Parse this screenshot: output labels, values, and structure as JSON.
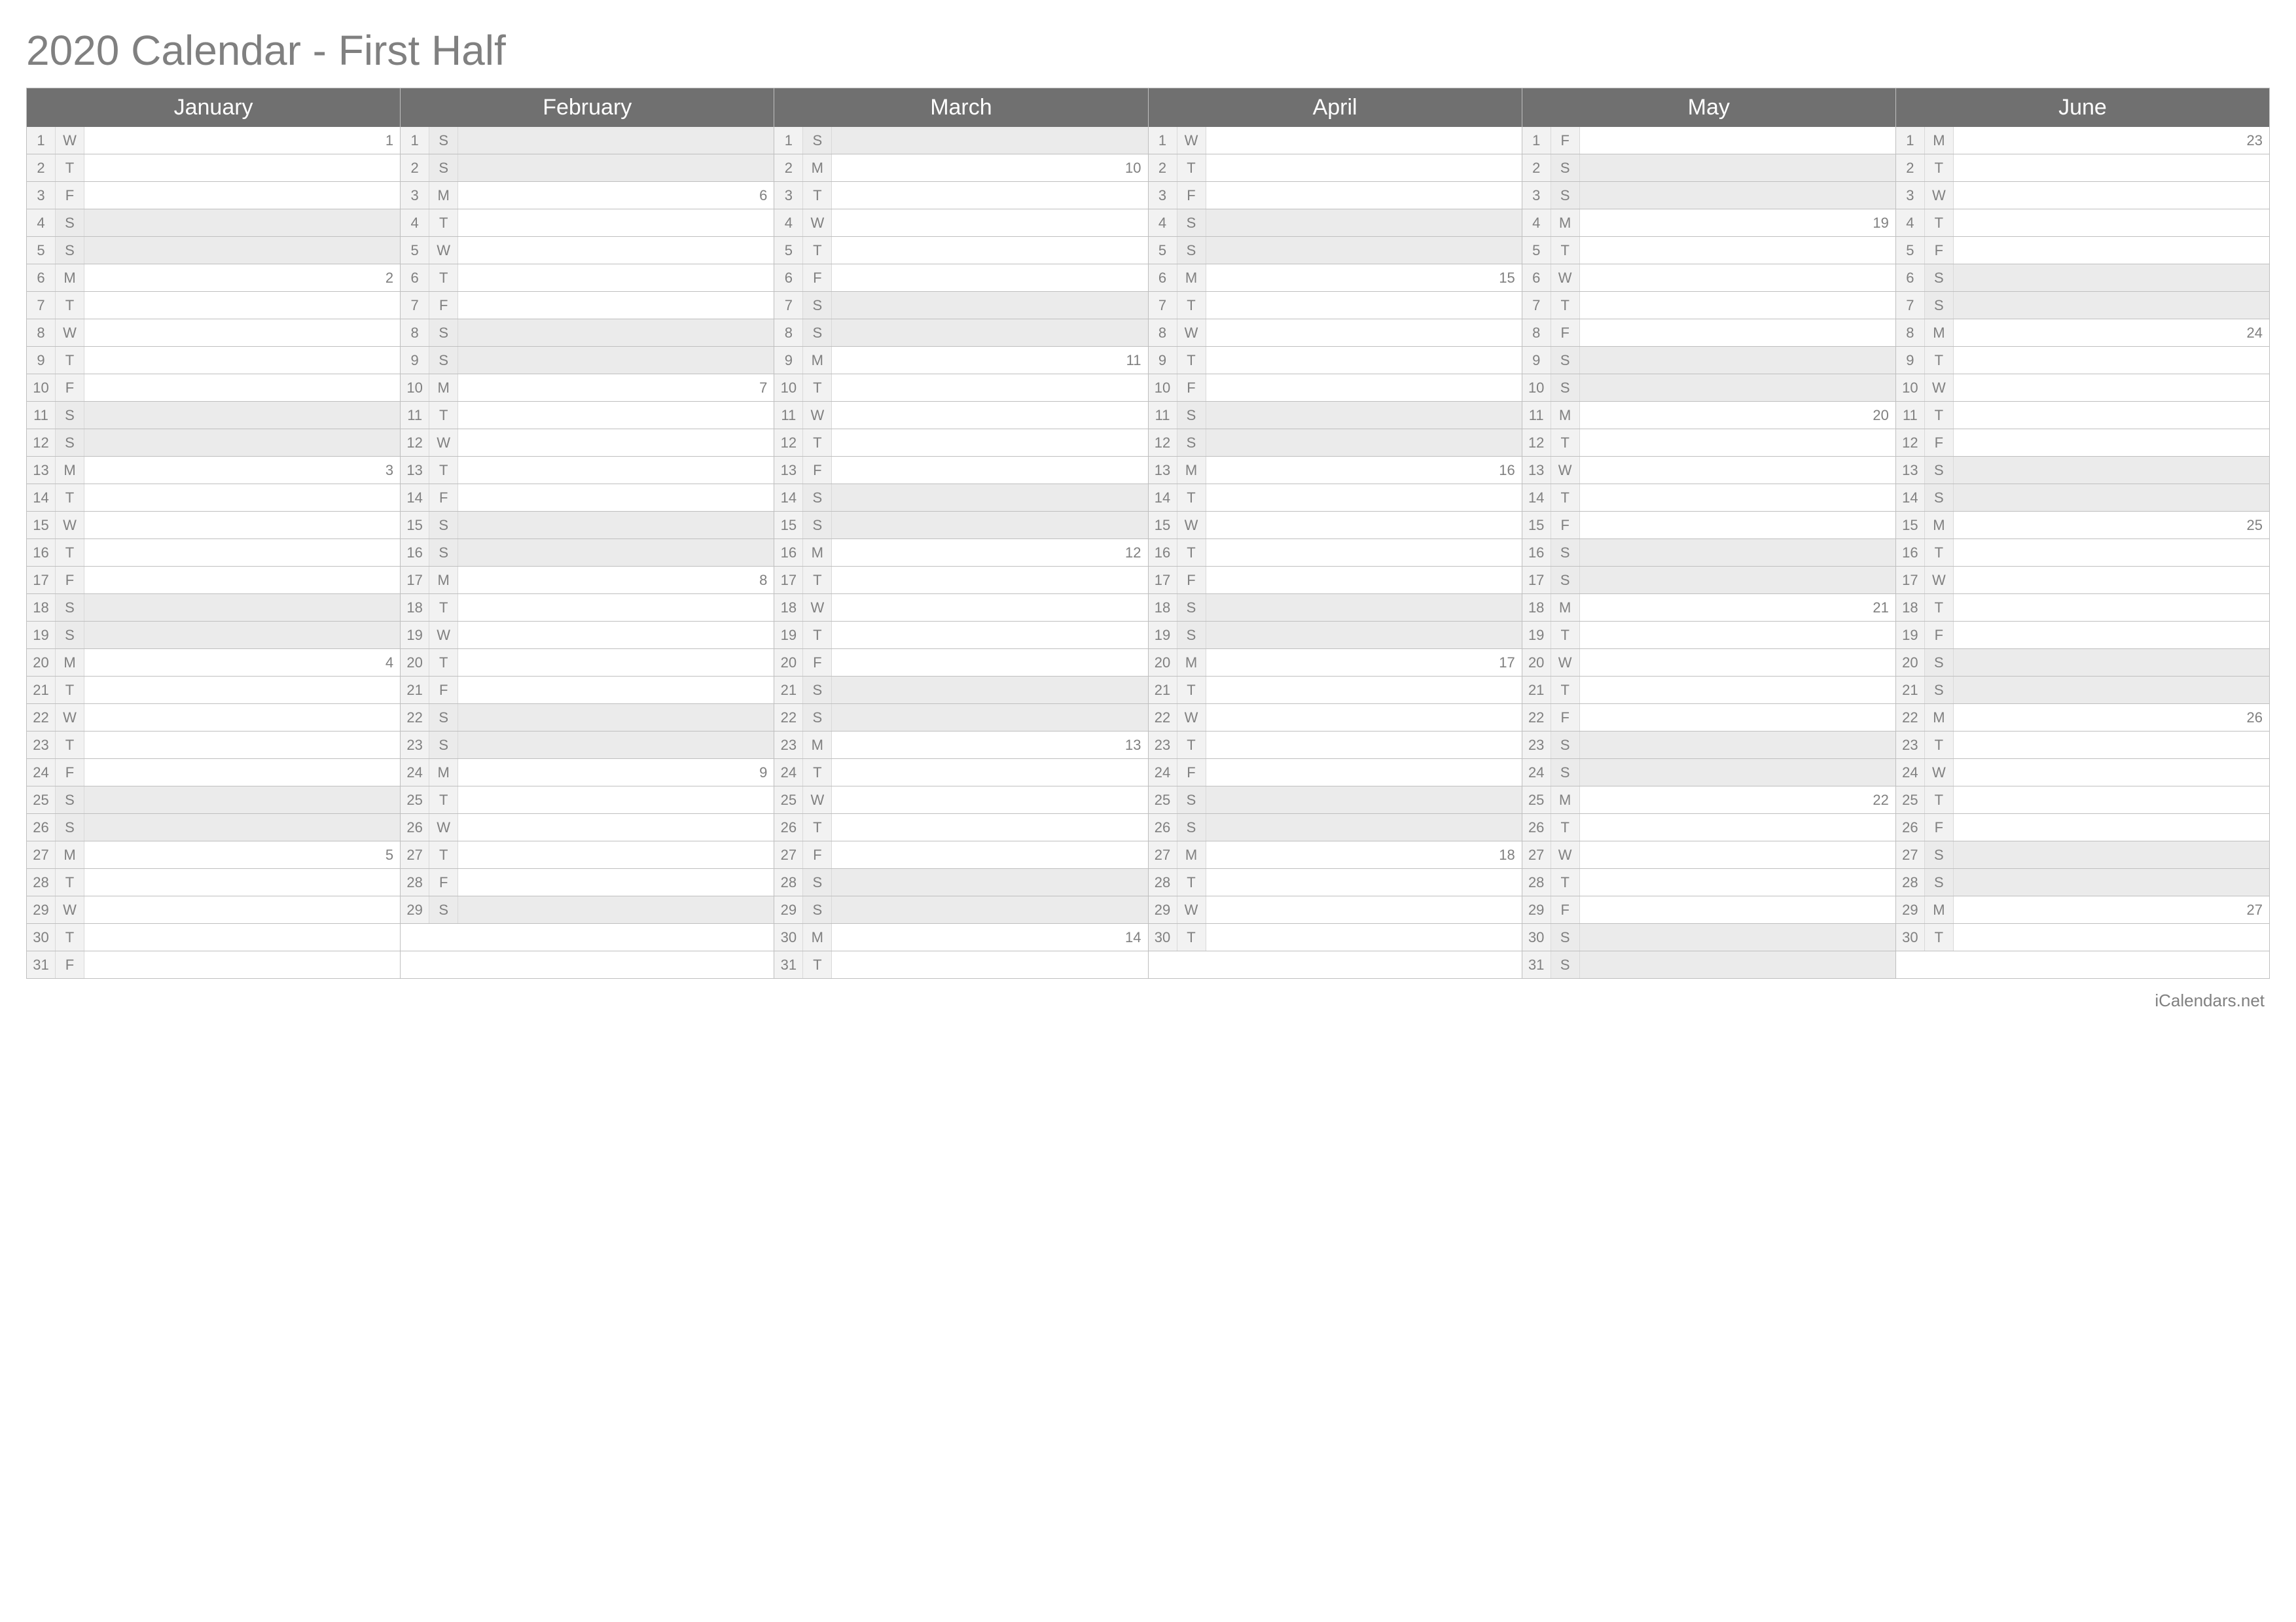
{
  "title": "2020 Calendar - First Half",
  "footer": "iCalendars.net",
  "maxDays": 31,
  "months": [
    {
      "name": "January",
      "days": [
        {
          "d": 1,
          "w": "W",
          "wk": "1"
        },
        {
          "d": 2,
          "w": "T"
        },
        {
          "d": 3,
          "w": "F"
        },
        {
          "d": 4,
          "w": "S",
          "we": true
        },
        {
          "d": 5,
          "w": "S",
          "we": true
        },
        {
          "d": 6,
          "w": "M",
          "wk": "2"
        },
        {
          "d": 7,
          "w": "T"
        },
        {
          "d": 8,
          "w": "W"
        },
        {
          "d": 9,
          "w": "T"
        },
        {
          "d": 10,
          "w": "F"
        },
        {
          "d": 11,
          "w": "S",
          "we": true
        },
        {
          "d": 12,
          "w": "S",
          "we": true
        },
        {
          "d": 13,
          "w": "M",
          "wk": "3"
        },
        {
          "d": 14,
          "w": "T"
        },
        {
          "d": 15,
          "w": "W"
        },
        {
          "d": 16,
          "w": "T"
        },
        {
          "d": 17,
          "w": "F"
        },
        {
          "d": 18,
          "w": "S",
          "we": true
        },
        {
          "d": 19,
          "w": "S",
          "we": true
        },
        {
          "d": 20,
          "w": "M",
          "wk": "4"
        },
        {
          "d": 21,
          "w": "T"
        },
        {
          "d": 22,
          "w": "W"
        },
        {
          "d": 23,
          "w": "T"
        },
        {
          "d": 24,
          "w": "F"
        },
        {
          "d": 25,
          "w": "S",
          "we": true
        },
        {
          "d": 26,
          "w": "S",
          "we": true
        },
        {
          "d": 27,
          "w": "M",
          "wk": "5"
        },
        {
          "d": 28,
          "w": "T"
        },
        {
          "d": 29,
          "w": "W"
        },
        {
          "d": 30,
          "w": "T"
        },
        {
          "d": 31,
          "w": "F"
        }
      ]
    },
    {
      "name": "February",
      "days": [
        {
          "d": 1,
          "w": "S",
          "we": true
        },
        {
          "d": 2,
          "w": "S",
          "we": true
        },
        {
          "d": 3,
          "w": "M",
          "wk": "6"
        },
        {
          "d": 4,
          "w": "T"
        },
        {
          "d": 5,
          "w": "W"
        },
        {
          "d": 6,
          "w": "T"
        },
        {
          "d": 7,
          "w": "F"
        },
        {
          "d": 8,
          "w": "S",
          "we": true
        },
        {
          "d": 9,
          "w": "S",
          "we": true
        },
        {
          "d": 10,
          "w": "M",
          "wk": "7"
        },
        {
          "d": 11,
          "w": "T"
        },
        {
          "d": 12,
          "w": "W"
        },
        {
          "d": 13,
          "w": "T"
        },
        {
          "d": 14,
          "w": "F"
        },
        {
          "d": 15,
          "w": "S",
          "we": true
        },
        {
          "d": 16,
          "w": "S",
          "we": true
        },
        {
          "d": 17,
          "w": "M",
          "wk": "8"
        },
        {
          "d": 18,
          "w": "T"
        },
        {
          "d": 19,
          "w": "W"
        },
        {
          "d": 20,
          "w": "T"
        },
        {
          "d": 21,
          "w": "F"
        },
        {
          "d": 22,
          "w": "S",
          "we": true
        },
        {
          "d": 23,
          "w": "S",
          "we": true
        },
        {
          "d": 24,
          "w": "M",
          "wk": "9"
        },
        {
          "d": 25,
          "w": "T"
        },
        {
          "d": 26,
          "w": "W"
        },
        {
          "d": 27,
          "w": "T"
        },
        {
          "d": 28,
          "w": "F"
        },
        {
          "d": 29,
          "w": "S",
          "we": true
        }
      ]
    },
    {
      "name": "March",
      "days": [
        {
          "d": 1,
          "w": "S",
          "we": true
        },
        {
          "d": 2,
          "w": "M",
          "wk": "10"
        },
        {
          "d": 3,
          "w": "T"
        },
        {
          "d": 4,
          "w": "W"
        },
        {
          "d": 5,
          "w": "T"
        },
        {
          "d": 6,
          "w": "F"
        },
        {
          "d": 7,
          "w": "S",
          "we": true
        },
        {
          "d": 8,
          "w": "S",
          "we": true
        },
        {
          "d": 9,
          "w": "M",
          "wk": "11"
        },
        {
          "d": 10,
          "w": "T"
        },
        {
          "d": 11,
          "w": "W"
        },
        {
          "d": 12,
          "w": "T"
        },
        {
          "d": 13,
          "w": "F"
        },
        {
          "d": 14,
          "w": "S",
          "we": true
        },
        {
          "d": 15,
          "w": "S",
          "we": true
        },
        {
          "d": 16,
          "w": "M",
          "wk": "12"
        },
        {
          "d": 17,
          "w": "T"
        },
        {
          "d": 18,
          "w": "W"
        },
        {
          "d": 19,
          "w": "T"
        },
        {
          "d": 20,
          "w": "F"
        },
        {
          "d": 21,
          "w": "S",
          "we": true
        },
        {
          "d": 22,
          "w": "S",
          "we": true
        },
        {
          "d": 23,
          "w": "M",
          "wk": "13"
        },
        {
          "d": 24,
          "w": "T"
        },
        {
          "d": 25,
          "w": "W"
        },
        {
          "d": 26,
          "w": "T"
        },
        {
          "d": 27,
          "w": "F"
        },
        {
          "d": 28,
          "w": "S",
          "we": true
        },
        {
          "d": 29,
          "w": "S",
          "we": true
        },
        {
          "d": 30,
          "w": "M",
          "wk": "14"
        },
        {
          "d": 31,
          "w": "T"
        }
      ]
    },
    {
      "name": "April",
      "days": [
        {
          "d": 1,
          "w": "W"
        },
        {
          "d": 2,
          "w": "T"
        },
        {
          "d": 3,
          "w": "F"
        },
        {
          "d": 4,
          "w": "S",
          "we": true
        },
        {
          "d": 5,
          "w": "S",
          "we": true
        },
        {
          "d": 6,
          "w": "M",
          "wk": "15"
        },
        {
          "d": 7,
          "w": "T"
        },
        {
          "d": 8,
          "w": "W"
        },
        {
          "d": 9,
          "w": "T"
        },
        {
          "d": 10,
          "w": "F"
        },
        {
          "d": 11,
          "w": "S",
          "we": true
        },
        {
          "d": 12,
          "w": "S",
          "we": true
        },
        {
          "d": 13,
          "w": "M",
          "wk": "16"
        },
        {
          "d": 14,
          "w": "T"
        },
        {
          "d": 15,
          "w": "W"
        },
        {
          "d": 16,
          "w": "T"
        },
        {
          "d": 17,
          "w": "F"
        },
        {
          "d": 18,
          "w": "S",
          "we": true
        },
        {
          "d": 19,
          "w": "S",
          "we": true
        },
        {
          "d": 20,
          "w": "M",
          "wk": "17"
        },
        {
          "d": 21,
          "w": "T"
        },
        {
          "d": 22,
          "w": "W"
        },
        {
          "d": 23,
          "w": "T"
        },
        {
          "d": 24,
          "w": "F"
        },
        {
          "d": 25,
          "w": "S",
          "we": true
        },
        {
          "d": 26,
          "w": "S",
          "we": true
        },
        {
          "d": 27,
          "w": "M",
          "wk": "18"
        },
        {
          "d": 28,
          "w": "T"
        },
        {
          "d": 29,
          "w": "W"
        },
        {
          "d": 30,
          "w": "T"
        }
      ]
    },
    {
      "name": "May",
      "days": [
        {
          "d": 1,
          "w": "F"
        },
        {
          "d": 2,
          "w": "S",
          "we": true
        },
        {
          "d": 3,
          "w": "S",
          "we": true
        },
        {
          "d": 4,
          "w": "M",
          "wk": "19"
        },
        {
          "d": 5,
          "w": "T"
        },
        {
          "d": 6,
          "w": "W"
        },
        {
          "d": 7,
          "w": "T"
        },
        {
          "d": 8,
          "w": "F"
        },
        {
          "d": 9,
          "w": "S",
          "we": true
        },
        {
          "d": 10,
          "w": "S",
          "we": true
        },
        {
          "d": 11,
          "w": "M",
          "wk": "20"
        },
        {
          "d": 12,
          "w": "T"
        },
        {
          "d": 13,
          "w": "W"
        },
        {
          "d": 14,
          "w": "T"
        },
        {
          "d": 15,
          "w": "F"
        },
        {
          "d": 16,
          "w": "S",
          "we": true
        },
        {
          "d": 17,
          "w": "S",
          "we": true
        },
        {
          "d": 18,
          "w": "M",
          "wk": "21"
        },
        {
          "d": 19,
          "w": "T"
        },
        {
          "d": 20,
          "w": "W"
        },
        {
          "d": 21,
          "w": "T"
        },
        {
          "d": 22,
          "w": "F"
        },
        {
          "d": 23,
          "w": "S",
          "we": true
        },
        {
          "d": 24,
          "w": "S",
          "we": true
        },
        {
          "d": 25,
          "w": "M",
          "wk": "22"
        },
        {
          "d": 26,
          "w": "T"
        },
        {
          "d": 27,
          "w": "W"
        },
        {
          "d": 28,
          "w": "T"
        },
        {
          "d": 29,
          "w": "F"
        },
        {
          "d": 30,
          "w": "S",
          "we": true
        },
        {
          "d": 31,
          "w": "S",
          "we": true
        }
      ]
    },
    {
      "name": "June",
      "days": [
        {
          "d": 1,
          "w": "M",
          "wk": "23"
        },
        {
          "d": 2,
          "w": "T"
        },
        {
          "d": 3,
          "w": "W"
        },
        {
          "d": 4,
          "w": "T"
        },
        {
          "d": 5,
          "w": "F"
        },
        {
          "d": 6,
          "w": "S",
          "we": true
        },
        {
          "d": 7,
          "w": "S",
          "we": true
        },
        {
          "d": 8,
          "w": "M",
          "wk": "24"
        },
        {
          "d": 9,
          "w": "T"
        },
        {
          "d": 10,
          "w": "W"
        },
        {
          "d": 11,
          "w": "T"
        },
        {
          "d": 12,
          "w": "F"
        },
        {
          "d": 13,
          "w": "S",
          "we": true
        },
        {
          "d": 14,
          "w": "S",
          "we": true
        },
        {
          "d": 15,
          "w": "M",
          "wk": "25"
        },
        {
          "d": 16,
          "w": "T"
        },
        {
          "d": 17,
          "w": "W"
        },
        {
          "d": 18,
          "w": "T"
        },
        {
          "d": 19,
          "w": "F"
        },
        {
          "d": 20,
          "w": "S",
          "we": true
        },
        {
          "d": 21,
          "w": "S",
          "we": true
        },
        {
          "d": 22,
          "w": "M",
          "wk": "26"
        },
        {
          "d": 23,
          "w": "T"
        },
        {
          "d": 24,
          "w": "W"
        },
        {
          "d": 25,
          "w": "T"
        },
        {
          "d": 26,
          "w": "F"
        },
        {
          "d": 27,
          "w": "S",
          "we": true
        },
        {
          "d": 28,
          "w": "S",
          "we": true
        },
        {
          "d": 29,
          "w": "M",
          "wk": "27"
        },
        {
          "d": 30,
          "w": "T"
        }
      ]
    }
  ]
}
